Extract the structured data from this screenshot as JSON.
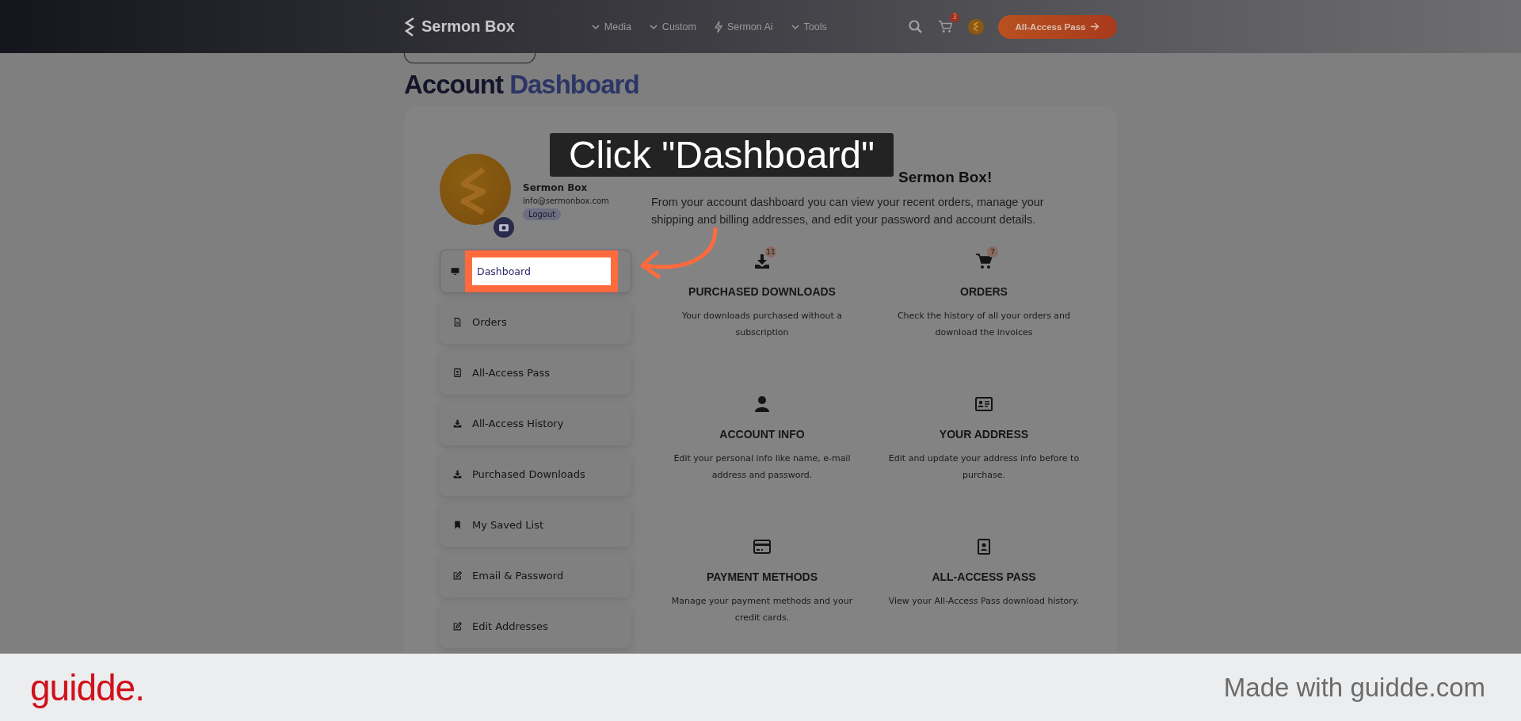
{
  "header": {
    "logo": "Sermon Box",
    "nav": [
      {
        "label": "Media",
        "kind": "dropdown"
      },
      {
        "label": "Custom",
        "kind": "dropdown"
      },
      {
        "label": "Sermon Ai",
        "kind": "bolt"
      },
      {
        "label": "Tools",
        "kind": "dropdown"
      }
    ],
    "cart_count": "3",
    "cta": "All-Access Pass"
  },
  "page_title": {
    "plain": "Account",
    "accent": "Dashboard"
  },
  "profile": {
    "name": "Sermon Box",
    "email": "info@sermonbox.com",
    "logout": "Logout"
  },
  "sidebar": [
    {
      "label": "Dashboard",
      "kind": "monitor",
      "selected": true
    },
    {
      "label": "Orders",
      "kind": "file",
      "selected": false
    },
    {
      "label": "All-Access Pass",
      "kind": "badge",
      "selected": false
    },
    {
      "label": "All-Access History",
      "kind": "download",
      "selected": false
    },
    {
      "label": "Purchased Downloads",
      "kind": "download",
      "selected": false
    },
    {
      "label": "My Saved List",
      "kind": "bookmark",
      "selected": false
    },
    {
      "label": "Email & Password",
      "kind": "edit",
      "selected": false
    },
    {
      "label": "Edit Addresses",
      "kind": "edit",
      "selected": false
    }
  ],
  "welcome": {
    "heading": "Sermon Box!",
    "text": "From your account dashboard you can view your recent orders, manage your shipping and billing addresses, and edit your password and account details."
  },
  "cards": [
    {
      "kind": "download",
      "badge": "11",
      "title": "PURCHASED DOWNLOADS",
      "text": "Your downloads purchased without a subscription"
    },
    {
      "kind": "cart",
      "badge": "7",
      "title": "ORDERS",
      "text": "Check the history of all your orders and download the invoices"
    },
    {
      "kind": "user",
      "title": "ACCOUNT INFO",
      "text": "Edit your personal info like name, e-mail address and password."
    },
    {
      "kind": "address",
      "title": "YOUR ADDRESS",
      "text": "Edit and update your address info before to purchase."
    },
    {
      "kind": "card",
      "title": "PAYMENT METHODS",
      "text": "Manage your payment methods and your credit cards."
    },
    {
      "kind": "badge",
      "title": "ALL-ACCESS PASS",
      "text": "View your All-Access Pass download history."
    }
  ],
  "callout": {
    "text": "Click \"Dashboard\""
  },
  "footer": {
    "logo": "guidde.",
    "tagline": "Made with guidde.com"
  }
}
